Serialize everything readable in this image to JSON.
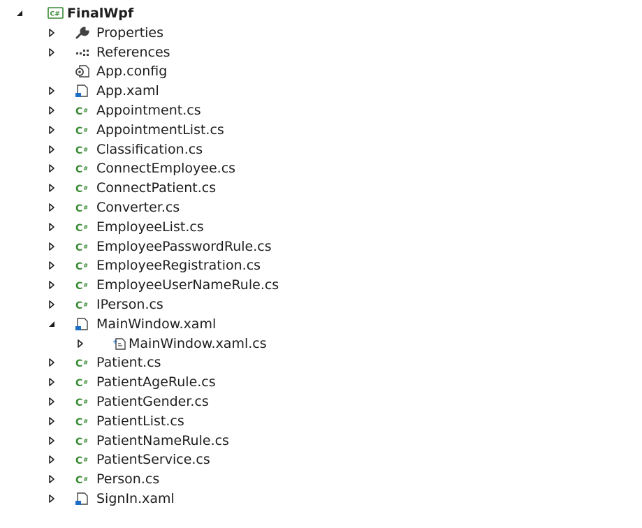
{
  "project": {
    "name": "FinalWpf",
    "icon": "csharp-project-icon",
    "expanded": true
  },
  "items": [
    {
      "label": "Properties",
      "icon": "wrench-icon",
      "expander": "collapsed",
      "depth": 1
    },
    {
      "label": "References",
      "icon": "references-icon",
      "expander": "collapsed",
      "depth": 1
    },
    {
      "label": "App.config",
      "icon": "config-file-icon",
      "expander": "none",
      "depth": 1
    },
    {
      "label": "App.xaml",
      "icon": "xaml-file-icon",
      "expander": "collapsed",
      "depth": 1
    },
    {
      "label": "Appointment.cs",
      "icon": "csharp-file-icon",
      "expander": "collapsed",
      "depth": 1
    },
    {
      "label": "AppointmentList.cs",
      "icon": "csharp-file-icon",
      "expander": "collapsed",
      "depth": 1
    },
    {
      "label": "Classification.cs",
      "icon": "csharp-file-icon",
      "expander": "collapsed",
      "depth": 1
    },
    {
      "label": "ConnectEmployee.cs",
      "icon": "csharp-file-icon",
      "expander": "collapsed",
      "depth": 1
    },
    {
      "label": "ConnectPatient.cs",
      "icon": "csharp-file-icon",
      "expander": "collapsed",
      "depth": 1
    },
    {
      "label": "Converter.cs",
      "icon": "csharp-file-icon",
      "expander": "collapsed",
      "depth": 1
    },
    {
      "label": "EmployeeList.cs",
      "icon": "csharp-file-icon",
      "expander": "collapsed",
      "depth": 1
    },
    {
      "label": "EmployeePasswordRule.cs",
      "icon": "csharp-file-icon",
      "expander": "collapsed",
      "depth": 1
    },
    {
      "label": "EmployeeRegistration.cs",
      "icon": "csharp-file-icon",
      "expander": "collapsed",
      "depth": 1
    },
    {
      "label": "EmployeeUserNameRule.cs",
      "icon": "csharp-file-icon",
      "expander": "collapsed",
      "depth": 1
    },
    {
      "label": "IPerson.cs",
      "icon": "csharp-file-icon",
      "expander": "collapsed",
      "depth": 1
    },
    {
      "label": "MainWindow.xaml",
      "icon": "xaml-file-icon",
      "expander": "expanded",
      "depth": 1
    },
    {
      "label": "MainWindow.xaml.cs",
      "icon": "code-behind-file-icon",
      "expander": "collapsed",
      "depth": 2
    },
    {
      "label": "Patient.cs",
      "icon": "csharp-file-icon",
      "expander": "collapsed",
      "depth": 1
    },
    {
      "label": "PatientAgeRule.cs",
      "icon": "csharp-file-icon",
      "expander": "collapsed",
      "depth": 1
    },
    {
      "label": "PatientGender.cs",
      "icon": "csharp-file-icon",
      "expander": "collapsed",
      "depth": 1
    },
    {
      "label": "PatientList.cs",
      "icon": "csharp-file-icon",
      "expander": "collapsed",
      "depth": 1
    },
    {
      "label": "PatientNameRule.cs",
      "icon": "csharp-file-icon",
      "expander": "collapsed",
      "depth": 1
    },
    {
      "label": "PatientService.cs",
      "icon": "csharp-file-icon",
      "expander": "collapsed",
      "depth": 1
    },
    {
      "label": "Person.cs",
      "icon": "csharp-file-icon",
      "expander": "collapsed",
      "depth": 1
    },
    {
      "label": "SignIn.xaml",
      "icon": "xaml-file-icon",
      "expander": "collapsed",
      "depth": 1
    }
  ],
  "colors": {
    "text": "#1e1e1e",
    "csharp_green": "#388a34",
    "xaml_blue": "#1e6fc4",
    "icon_gray": "#424242"
  }
}
